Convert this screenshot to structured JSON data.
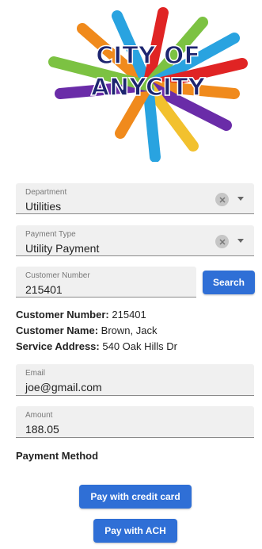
{
  "logo": {
    "line1": "CITY OF",
    "line2": "ANYCITY"
  },
  "department": {
    "label": "Department",
    "value": "Utilities"
  },
  "payment_type": {
    "label": "Payment Type",
    "value": "Utility Payment"
  },
  "customer_number_field": {
    "label": "Customer Number",
    "value": "215401"
  },
  "search_label": "Search",
  "customer_info": {
    "number_label": "Customer Number:",
    "number_value": "215401",
    "name_label": "Customer Name:",
    "name_value": "Brown, Jack",
    "address_label": "Service Address:",
    "address_value": "540 Oak Hills Dr"
  },
  "email": {
    "label": "Email",
    "value": "joe@gmail.com"
  },
  "amount": {
    "label": "Amount",
    "value": "188.05"
  },
  "payment_method_title": "Payment Method",
  "buttons": {
    "credit_card": "Pay with credit card",
    "ach": "Pay with ACH"
  },
  "colors": {
    "primary": "#2f6fd6",
    "field_bg": "#f0f0f0"
  },
  "icons": {
    "clear": "clear-icon",
    "dropdown": "chevron-down-icon"
  }
}
